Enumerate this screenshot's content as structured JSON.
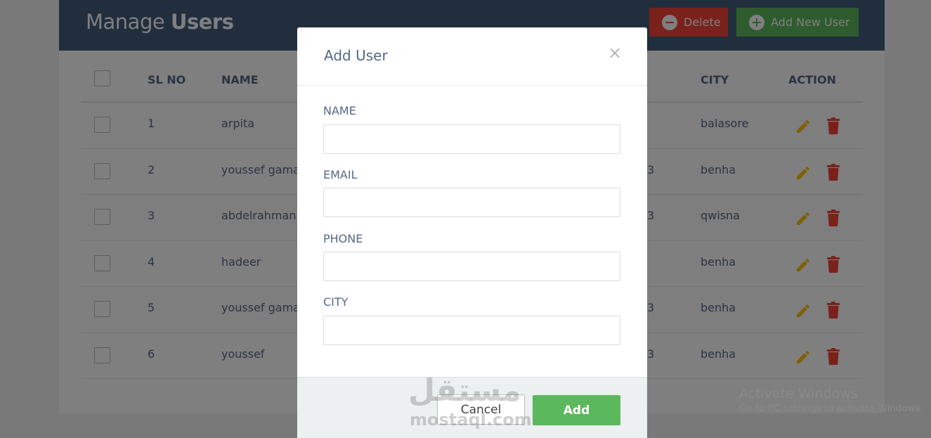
{
  "header": {
    "title_prefix": "Manage ",
    "title_bold": "Users",
    "delete_label": "Delete",
    "add_label": "Add New User"
  },
  "table": {
    "columns": {
      "sl_no": "SL NO",
      "name": "NAME",
      "city": "CITY",
      "action": "ACTION"
    },
    "rows": [
      {
        "sl": "1",
        "name": "arpita",
        "phone_tail": "",
        "city": "balasore"
      },
      {
        "sl": "2",
        "name": "youssef gama",
        "phone_tail": "3",
        "city": "benha"
      },
      {
        "sl": "3",
        "name": "abdelrahman",
        "phone_tail": "3",
        "city": "qwisna"
      },
      {
        "sl": "4",
        "name": "hadeer",
        "phone_tail": "",
        "city": "benha"
      },
      {
        "sl": "5",
        "name": "youssef gama",
        "phone_tail": "3",
        "city": "benha"
      },
      {
        "sl": "6",
        "name": "youssef",
        "phone_tail": "3",
        "city": "benha"
      }
    ]
  },
  "modal": {
    "title": "Add User",
    "close_glyph": "×",
    "fields": {
      "name_label": "NAME",
      "email_label": "EMAIL",
      "phone_label": "PHONE",
      "city_label": "CITY"
    },
    "cancel_label": "Cancel",
    "submit_label": "Add"
  },
  "watermark": {
    "arabic": "مستقل",
    "url": "mostaql.com"
  },
  "windows_activation": {
    "title": "Activate Windows",
    "subtitle": "Go to PC settings to activate Windows."
  },
  "colors": {
    "header_bg": "#435d7d",
    "delete": "#f44336",
    "add": "#5cb85c",
    "edit_icon": "#ffc107",
    "delete_icon": "#f44336",
    "text": "#566787"
  }
}
